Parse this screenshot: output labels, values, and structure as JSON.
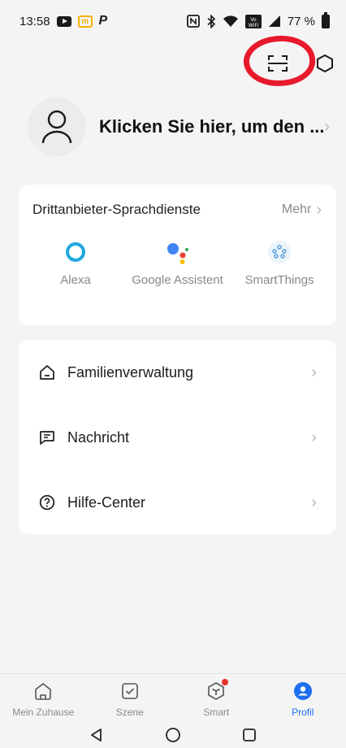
{
  "status_bar": {
    "time": "13:58",
    "battery": "77 %",
    "icons": [
      "youtube-icon",
      "mcdonalds-icon",
      "paypal-icon",
      "nfc-icon",
      "bluetooth-icon",
      "wifi-icon",
      "vowifi-icon",
      "signal-icon",
      "battery-icon"
    ]
  },
  "top_actions": {
    "icons": [
      "scan-icon",
      "settings-hex-icon"
    ],
    "annotation_color": "#e8192c"
  },
  "profile": {
    "name": "Klicken Sie hier, um den ..."
  },
  "voice_services": {
    "title": "Drittanbieter-Sprachdienste",
    "more_label": "Mehr",
    "items": [
      {
        "label": "Alexa",
        "icon": "alexa-icon"
      },
      {
        "label": "Google Assistent",
        "icon": "google-assistant-icon"
      },
      {
        "label": "SmartThings",
        "icon": "smartthings-icon"
      }
    ]
  },
  "menu": {
    "items": [
      {
        "label": "Familienverwaltung",
        "icon": "home-icon"
      },
      {
        "label": "Nachricht",
        "icon": "message-icon"
      },
      {
        "label": "Hilfe-Center",
        "icon": "help-icon"
      }
    ]
  },
  "tabs": [
    {
      "label": "Mein Zuhause",
      "icon": "home-icon",
      "active": false
    },
    {
      "label": "Szene",
      "icon": "checkbox-icon",
      "active": false
    },
    {
      "label": "Smart",
      "icon": "cube-icon",
      "active": false,
      "badge": true
    },
    {
      "label": "Profil",
      "icon": "profile-icon",
      "active": true
    }
  ],
  "colors": {
    "accent": "#1e6ef0",
    "background": "#f4f4f5",
    "badge": "#e8312c",
    "alexa": "#1fa8e0"
  }
}
